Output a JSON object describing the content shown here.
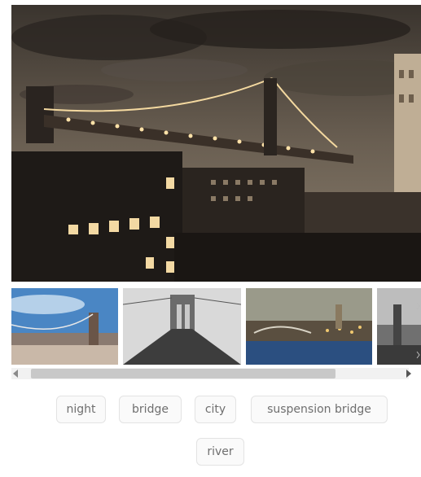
{
  "gallery": {
    "thumbnails": [
      {
        "icon": "thumbnail-brooklyn-bridge-blue-sky"
      },
      {
        "icon": "thumbnail-bridge-walkway-bw"
      },
      {
        "icon": "thumbnail-city-river-night"
      },
      {
        "icon": "thumbnail-partial-bw"
      }
    ]
  },
  "tags": [
    {
      "label": "night"
    },
    {
      "label": "bridge"
    },
    {
      "label": "city"
    },
    {
      "label": "suspension bridge"
    },
    {
      "label": "river"
    }
  ],
  "colors": {
    "tag_border": "#e3e3e3",
    "tag_text": "#6f6f6f",
    "scroll_thumb": "#c8c8c8"
  }
}
